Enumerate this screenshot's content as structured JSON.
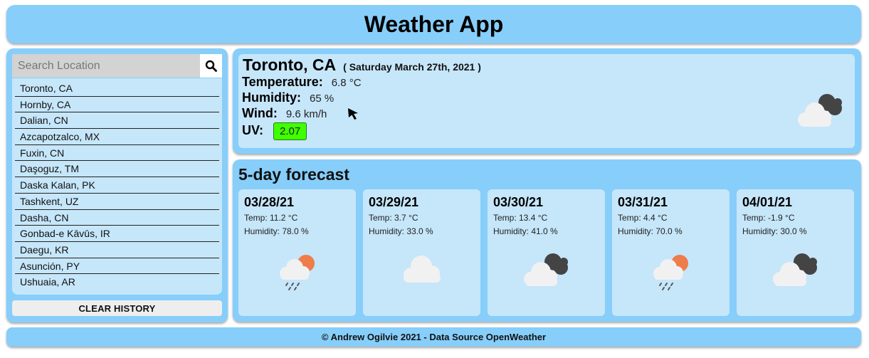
{
  "header": {
    "title": "Weather App"
  },
  "search": {
    "placeholder": "Search Location",
    "value": ""
  },
  "history": [
    "Toronto, CA",
    "Hornby, CA",
    "Dalian, CN",
    "Azcapotzalco, MX",
    "Fuxin, CN",
    "Daşoguz, TM",
    "Daska Kalan, PK",
    "Tashkent, UZ",
    "Dasha, CN",
    "Gonbad-e Kāvūs, IR",
    "Daegu, KR",
    "Asunción, PY",
    "Ushuaia, AR"
  ],
  "clear_label": "CLEAR HISTORY",
  "current": {
    "city": "Toronto, CA",
    "date": "( Saturday March 27th, 2021 )",
    "temperature_label": "Temperature:",
    "temperature": "6.8 °C",
    "humidity_label": "Humidity:",
    "humidity": "65 %",
    "wind_label": "Wind:",
    "wind": "9.6 km/h",
    "uv_label": "UV:",
    "uv": "2.07",
    "uv_color": "#3fff00",
    "icon": "cloudy-dark-icon"
  },
  "forecast": {
    "title": "5-day forecast",
    "days": [
      {
        "date": "03/28/21",
        "temp": "Temp: 11.2 °C",
        "humidity": "Humidity: 78.0 %",
        "icon": "rain-sun-icon"
      },
      {
        "date": "03/29/21",
        "temp": "Temp: 3.7 °C",
        "humidity": "Humidity: 33.0 %",
        "icon": "cloud-icon"
      },
      {
        "date": "03/30/21",
        "temp": "Temp: 13.4 °C",
        "humidity": "Humidity: 41.0 %",
        "icon": "cloudy-dark-icon"
      },
      {
        "date": "03/31/21",
        "temp": "Temp: 4.4 °C",
        "humidity": "Humidity: 70.0 %",
        "icon": "rain-sun-icon"
      },
      {
        "date": "04/01/21",
        "temp": "Temp: -1.9 °C",
        "humidity": "Humidity: 30.0 %",
        "icon": "cloudy-dark-icon"
      }
    ]
  },
  "footer": {
    "text": "© Andrew Ogilvie 2021 - Data Source OpenWeather"
  }
}
